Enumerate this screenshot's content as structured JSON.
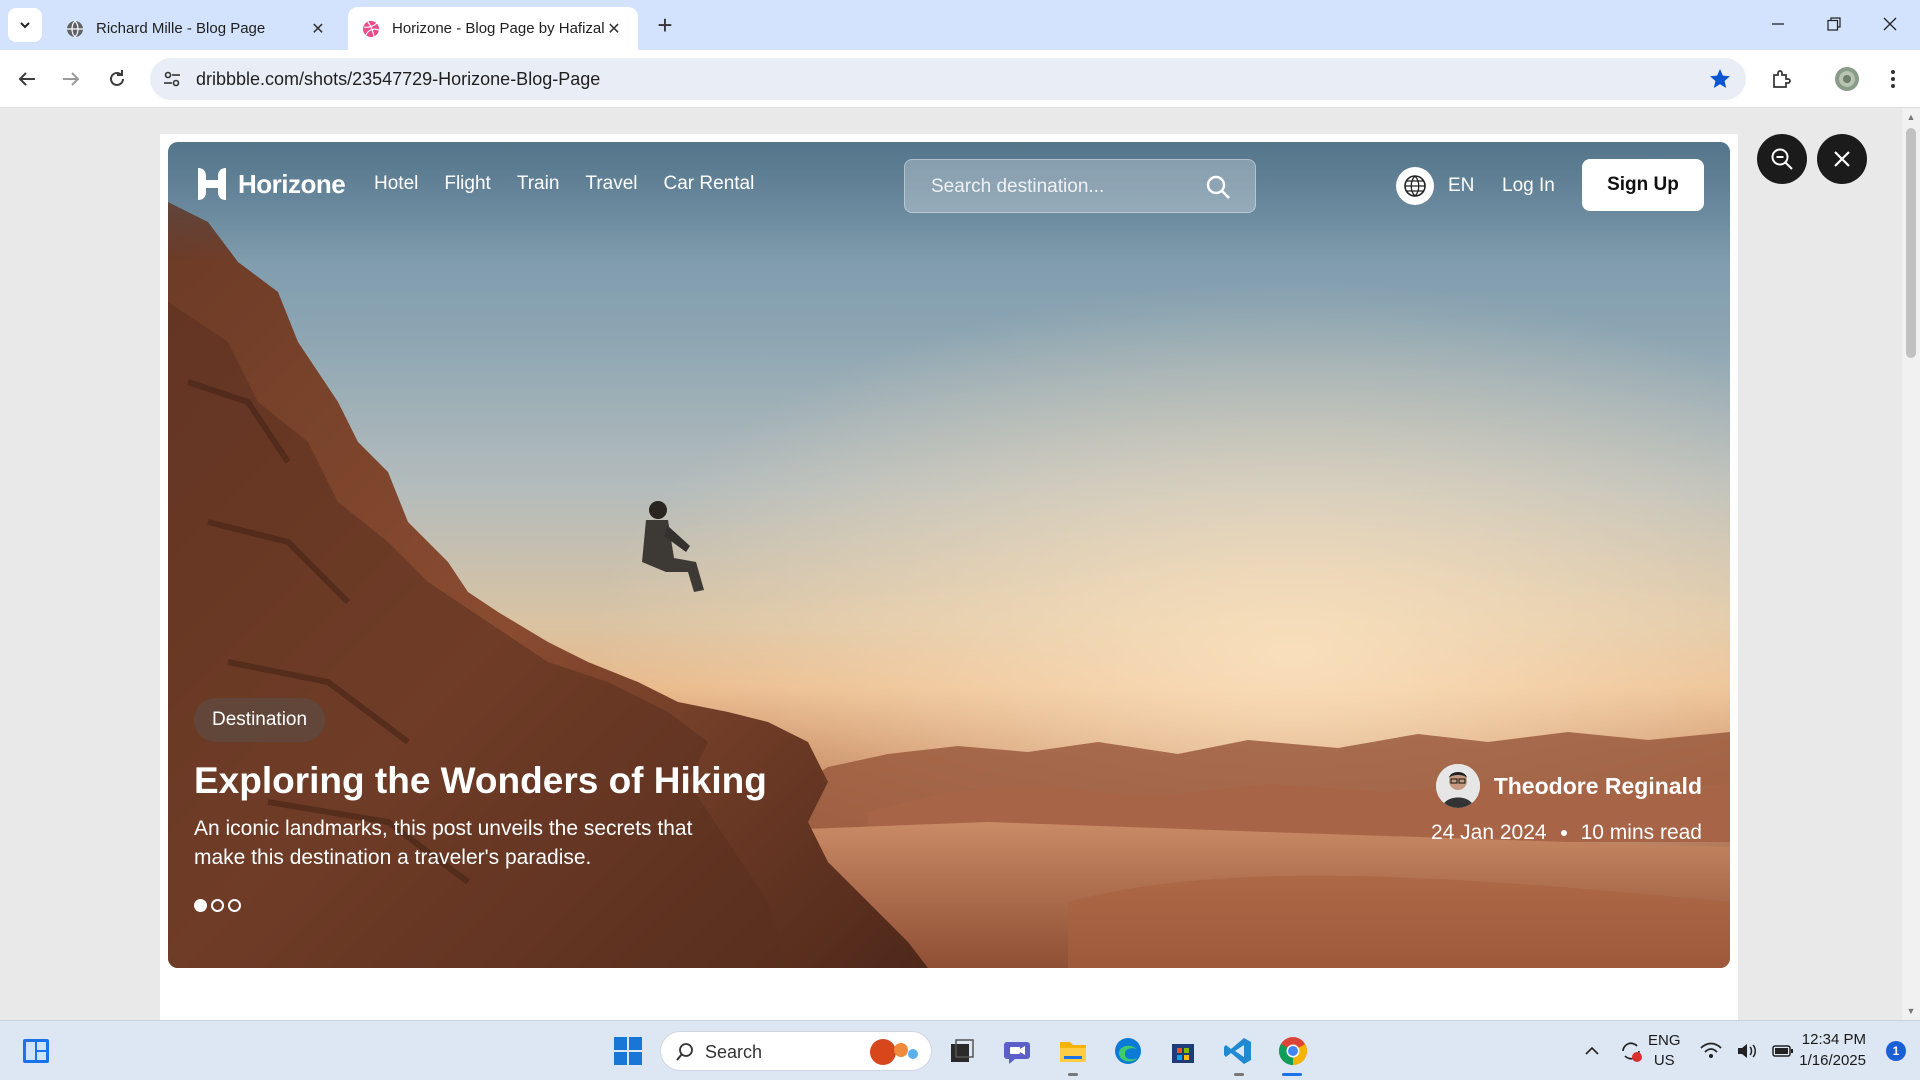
{
  "browser": {
    "tabs": [
      {
        "title": "Richard Mille - Blog Page",
        "active": false
      },
      {
        "title": "Horizone - Blog Page by Hafizal",
        "active": true
      }
    ],
    "url": "dribbble.com/shots/23547729-Horizone-Blog-Page"
  },
  "site": {
    "brand": "Horizone",
    "nav": [
      "Hotel",
      "Flight",
      "Train",
      "Travel",
      "Car Rental"
    ],
    "search_placeholder": "Search destination...",
    "language": "EN",
    "login_label": "Log In",
    "signup_label": "Sign Up"
  },
  "hero": {
    "category": "Destination",
    "title": "Exploring the Wonders of Hiking",
    "description": "An iconic landmarks, this post unveils the secrets that make this destination a traveler's paradise.",
    "author": "Theodore Reginald",
    "date": "24 Jan 2024",
    "read_time": "10 mins read",
    "slide_count": 3,
    "active_slide": 1
  },
  "taskbar": {
    "search_label": "Search",
    "language": "ENG",
    "region": "US",
    "time": "12:34 PM",
    "date": "1/16/2025",
    "notifications": "1"
  },
  "colors": {
    "chrome_tabbar": "#d3e3fd",
    "accent_blue": "#1a73e8",
    "taskbar": "#dde6f3"
  }
}
